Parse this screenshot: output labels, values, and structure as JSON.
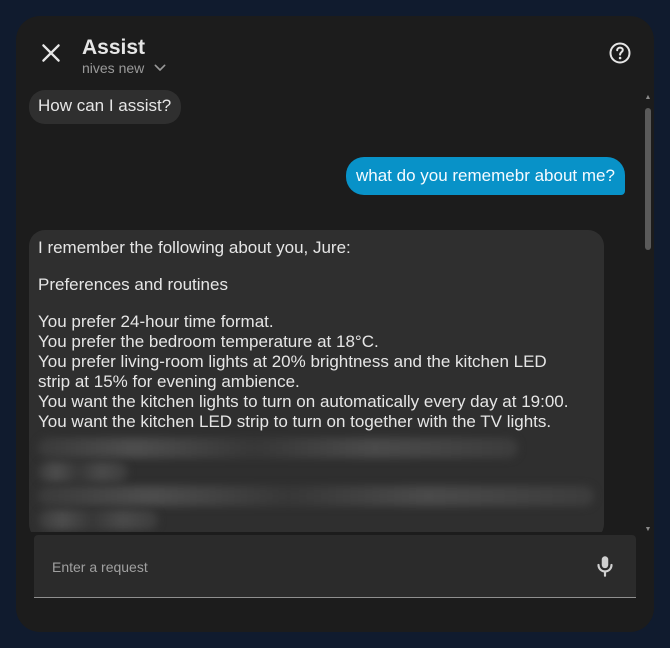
{
  "dialog": {
    "title": "Assist",
    "pipeline": "nives new"
  },
  "messages": {
    "greeting": "How can I assist?",
    "user": "what do you rememebr about me?",
    "answer": {
      "intro": "I remember the following about you, Jure:",
      "heading": "Preferences and routines",
      "lines": [
        "You prefer 24-hour time format.",
        "You prefer the bedroom temperature at 18°C.",
        "You prefer living-room lights at 20% brightness and the kitchen LED",
        "strip at 15% for evening ambience.",
        "You want the kitchen lights to turn on automatically every day at 19:00.",
        "You want the kitchen LED strip to turn on together with the TV lights."
      ]
    }
  },
  "input": {
    "placeholder": "Enter a request"
  },
  "icons": {
    "close": "close-icon",
    "help": "help-circle-icon",
    "dropdown": "chevron-down-icon",
    "mic": "microphone-icon"
  },
  "colors": {
    "user_bubble": "#0892c8",
    "assistant_bubble": "#2f2f2f",
    "dialog_bg": "#1c1c1c",
    "page_bg": "#101b2e"
  }
}
